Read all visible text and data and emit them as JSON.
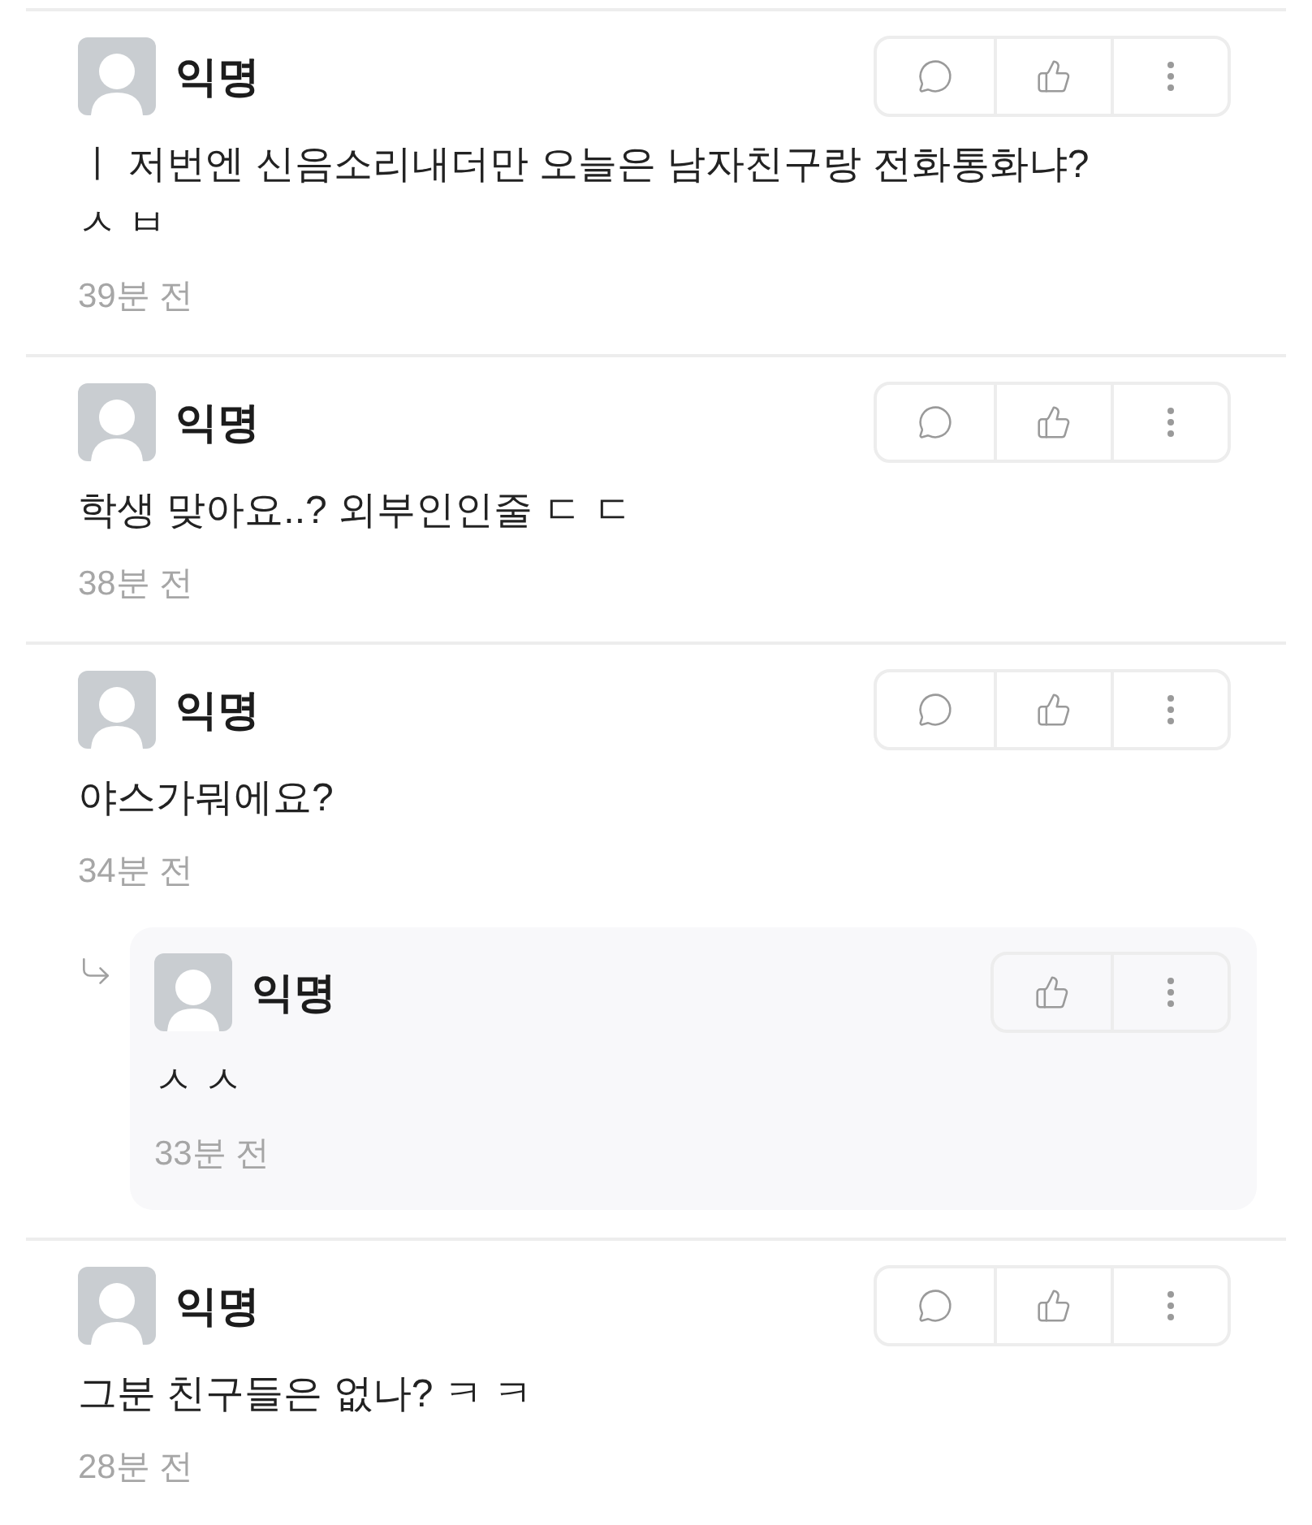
{
  "comments": [
    {
      "author": "익명",
      "body": [
        "ㅣ 저번엔 신음소리내더만 오늘은 남자친구랑 전화통화냐?",
        "ㅅ ㅂ"
      ],
      "time": "39분 전",
      "buttons": [
        {
          "kind": "reply"
        },
        {
          "kind": "like"
        },
        {
          "kind": "more"
        }
      ]
    },
    {
      "author": "익명",
      "body": [
        "학생 맞아요..? 외부인인줄 ㄷ ㄷ"
      ],
      "time": "38분 전",
      "buttons": [
        {
          "kind": "reply"
        },
        {
          "kind": "like"
        },
        {
          "kind": "more"
        }
      ]
    },
    {
      "author": "익명",
      "body": [
        "야스가뭐에요?"
      ],
      "time": "34분 전",
      "buttons": [
        {
          "kind": "reply"
        },
        {
          "kind": "like"
        },
        {
          "kind": "more"
        }
      ],
      "replies": [
        {
          "author": "익명",
          "body": [
            "ㅅ ㅅ"
          ],
          "time": "33분 전",
          "buttons": [
            {
              "kind": "like"
            },
            {
              "kind": "more"
            }
          ]
        }
      ]
    },
    {
      "author": "익명",
      "body": [
        "그분 친구들은 없나? ㅋ ㅋ"
      ],
      "time": "28분 전",
      "buttons": [
        {
          "kind": "reply"
        },
        {
          "kind": "like"
        },
        {
          "kind": "more"
        }
      ]
    }
  ]
}
